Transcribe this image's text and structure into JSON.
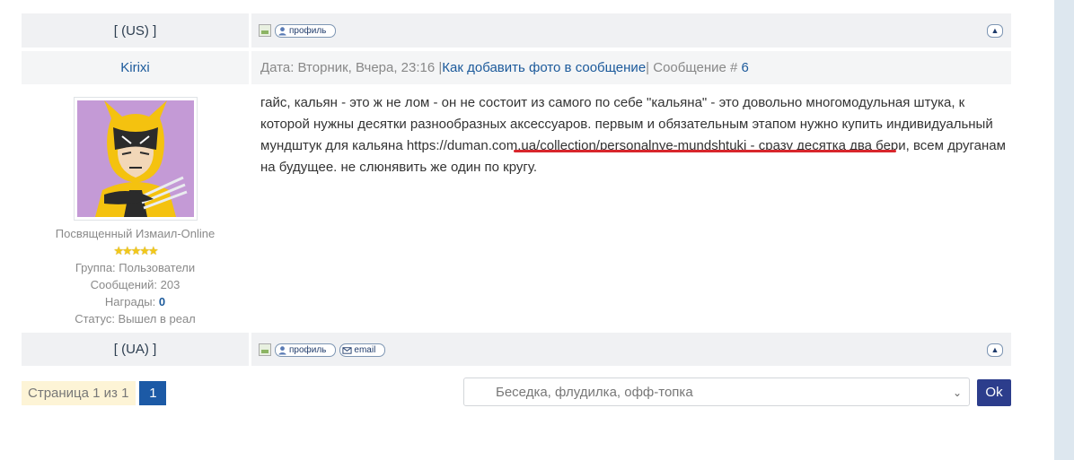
{
  "rows": {
    "prev_footer": {
      "lang": "[ (US) ]"
    },
    "post_header": {
      "nick": "Kirixi",
      "date_prefix": "Дата: Вторник, Вчера, 23:16 |",
      "howto_link": "Как добавить фото в сообщение",
      "msg_prefix": "| Сообщение # ",
      "msg_num": "6"
    },
    "post_body": {
      "text_before": "гайс, кальян - это ж не лом - он не состоит из самого по себе \"кальяна\" - это довольно многомодульная штука, к которой нужны десятки разнообразных аксессуаров. первым и обязательным этапом нужно купить индивидуальный мундштук для кальяна ",
      "link": "https://duman.com.ua/collection/personalnye-mundshtuki",
      "text_after": " - сразу десятка два бери, всем друганам на будущее. не слюнявить же один по кругу.",
      "user": {
        "title": "Посвященный Измаил-Online",
        "stars": "★★★★★",
        "group_label": "Группа: Пользователи",
        "messages_label": "Сообщений: 203",
        "awards_label": "Награды: ",
        "awards_value": "0",
        "status_label": "Статус: Вышел в реал"
      }
    },
    "post_footer": {
      "lang": "[ (UA) ]"
    }
  },
  "buttons": {
    "profile": "профиль",
    "email": "email"
  },
  "icons": {
    "broken_image": "broken-image-icon",
    "profile": "person-icon",
    "email": "envelope-icon",
    "up": "arrow-up-icon",
    "dropdown": "chevron-down-icon"
  },
  "pager": {
    "label": "Страница 1 из 1",
    "current": "1"
  },
  "forum_select": {
    "value": "Беседка, флудилка, офф-топка",
    "go_label": "Ok"
  },
  "colors": {
    "link": "#1c5a9b",
    "pager_active": "#1c5aa6",
    "ok_button": "#2c3d8c",
    "highlight_underline": "#d8262c",
    "row_gray": "#f0f1f3"
  }
}
